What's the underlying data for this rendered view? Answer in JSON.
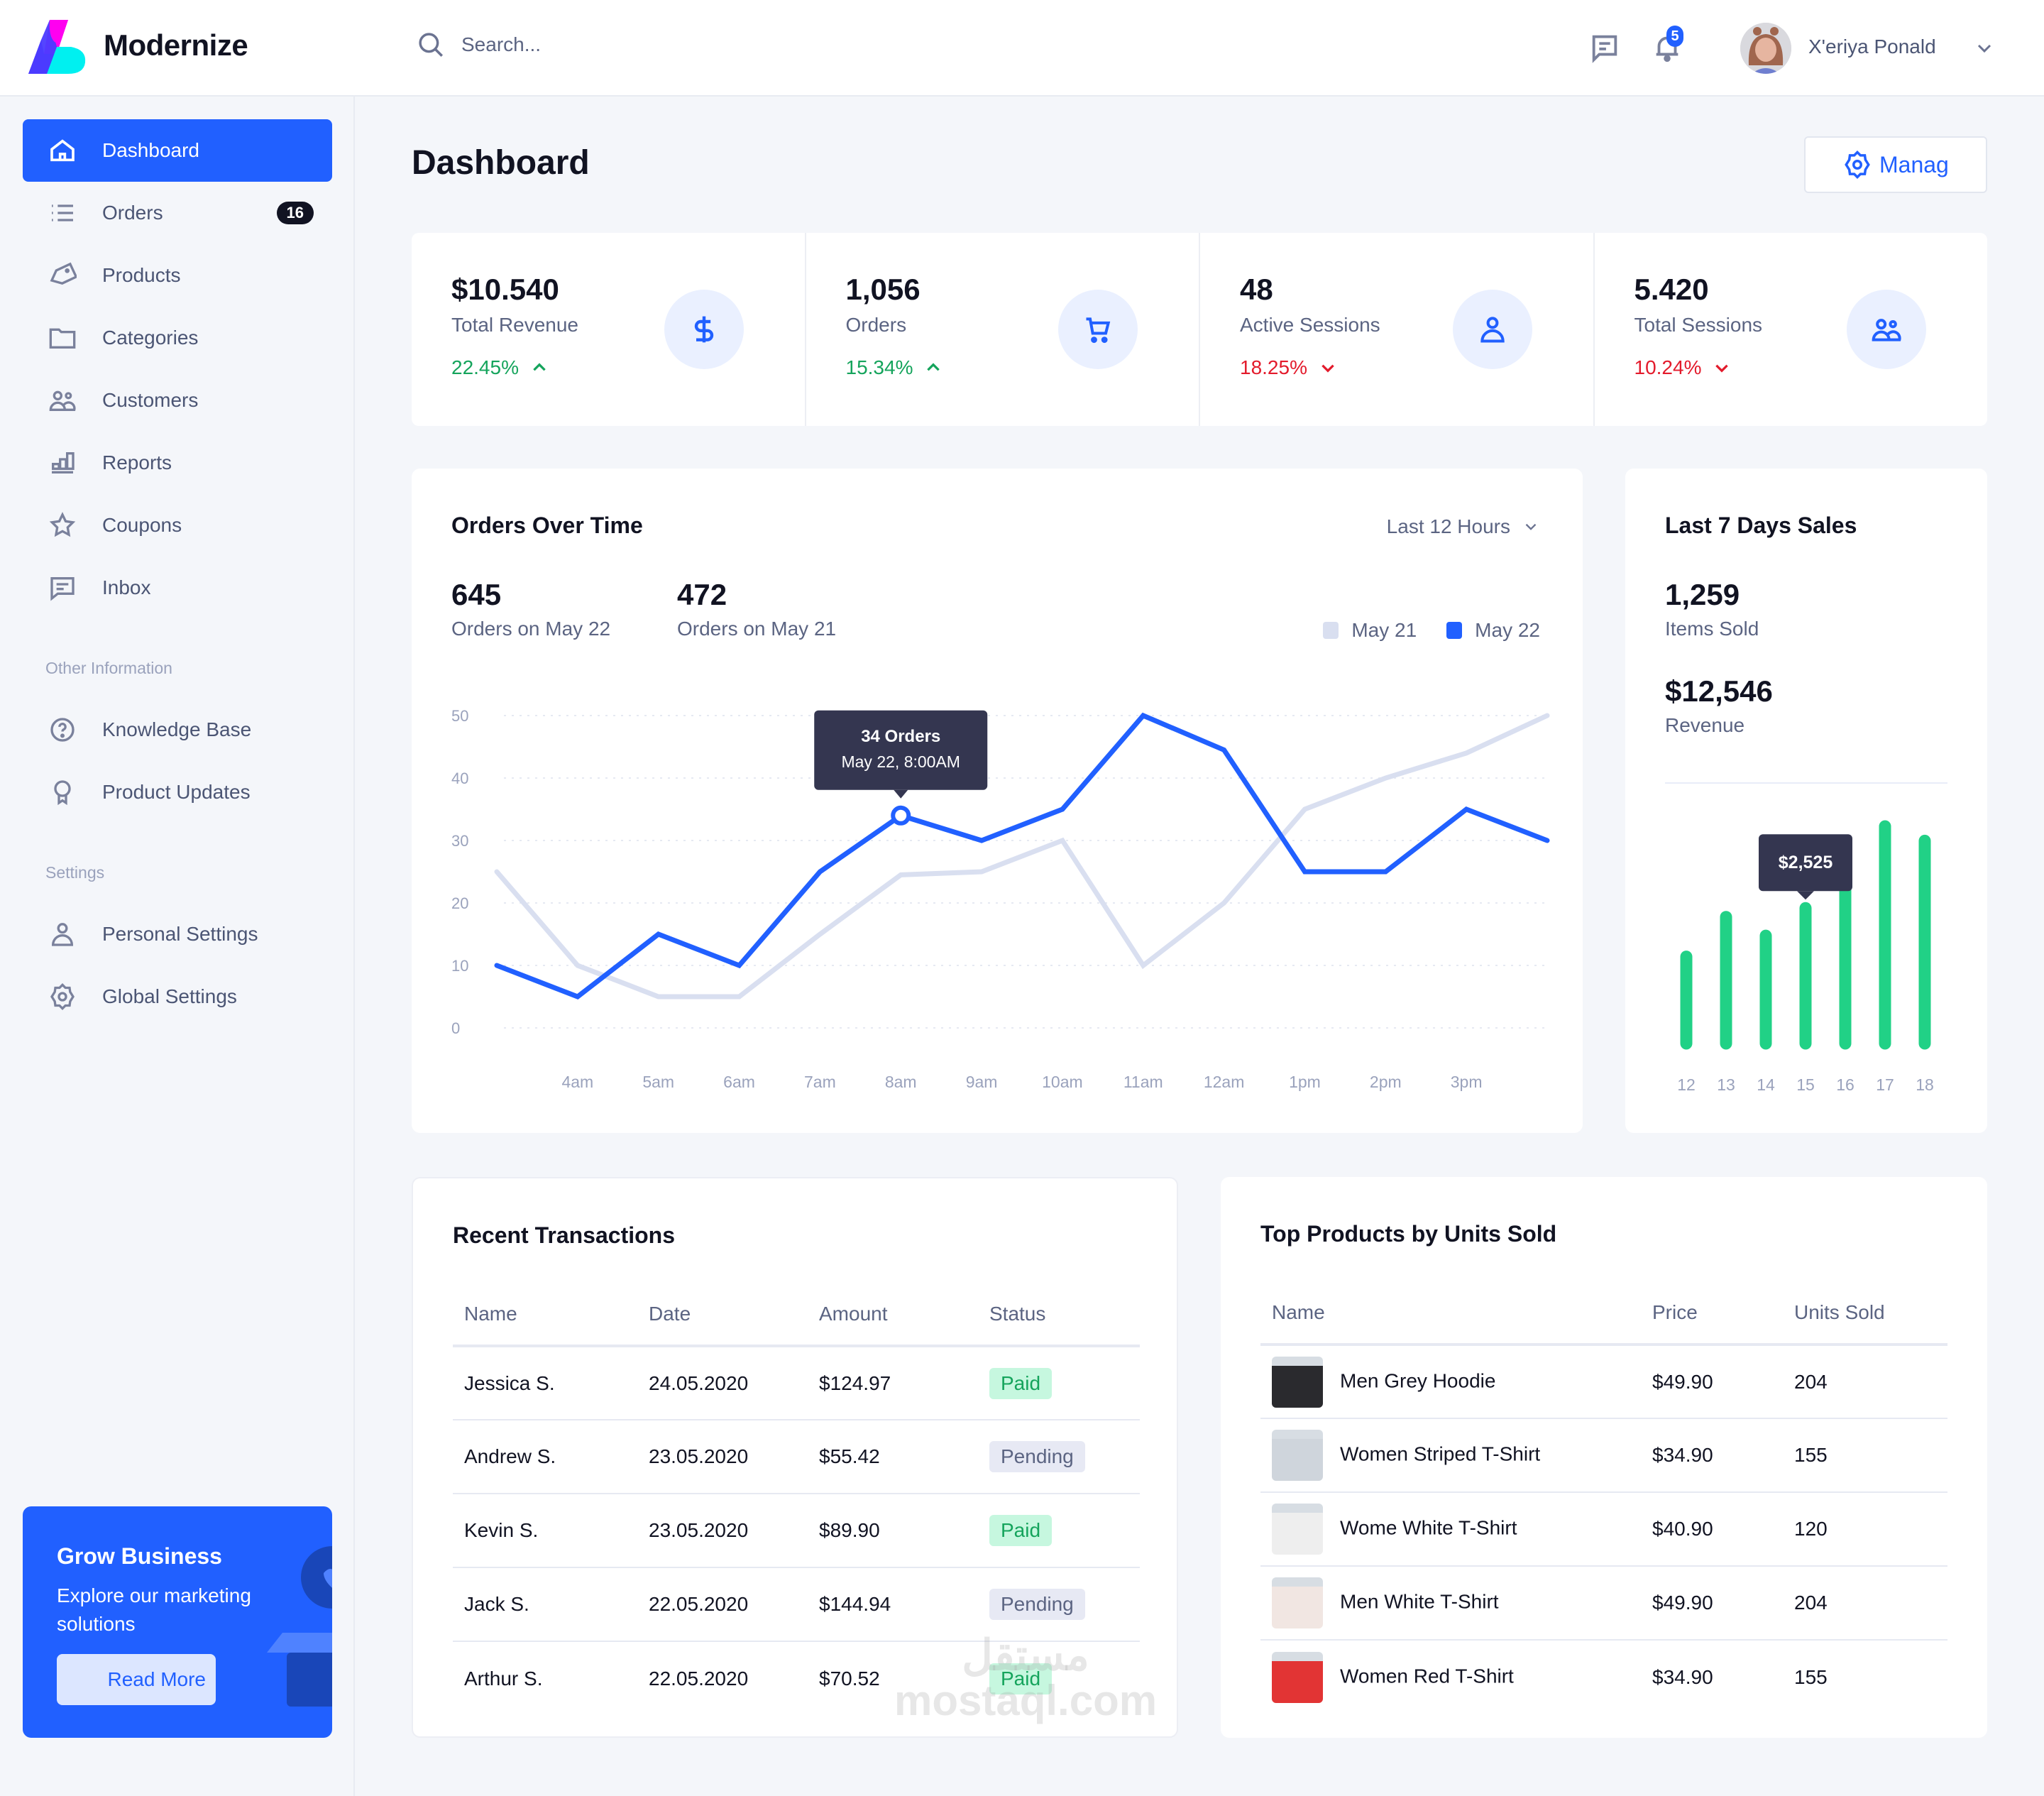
{
  "header": {
    "brand": "Modernize",
    "search_placeholder": "Search...",
    "notifications_count": "5",
    "user_name": "X'eriya Ponald"
  },
  "sidebar": {
    "items": [
      {
        "label": "Dashboard",
        "icon": "home-icon",
        "active": true
      },
      {
        "label": "Orders",
        "icon": "list-icon",
        "count": "16"
      },
      {
        "label": "Products",
        "icon": "tag-icon"
      },
      {
        "label": "Categories",
        "icon": "folder-icon"
      },
      {
        "label": "Customers",
        "icon": "users-icon"
      },
      {
        "label": "Reports",
        "icon": "bar-chart-icon"
      },
      {
        "label": "Coupons",
        "icon": "star-icon"
      },
      {
        "label": "Inbox",
        "icon": "message-icon"
      }
    ],
    "section_other": "Other Information",
    "other_items": [
      {
        "label": "Knowledge Base",
        "icon": "help-circle-icon"
      },
      {
        "label": "Product Updates",
        "icon": "award-icon"
      }
    ],
    "section_settings": "Settings",
    "settings_items": [
      {
        "label": "Personal Settings",
        "icon": "user-icon"
      },
      {
        "label": "Global Settings",
        "icon": "gear-icon"
      }
    ],
    "promo": {
      "title": "Grow Business",
      "text": "Explore our marketing solutions",
      "button": "Read More"
    }
  },
  "page": {
    "title": "Dashboard",
    "manage_button": "Manag"
  },
  "kpis": [
    {
      "value": "$10.540",
      "label": "Total Revenue",
      "delta": "22.45%",
      "trend": "up",
      "icon": "dollar-icon"
    },
    {
      "value": "1,056",
      "label": "Orders",
      "delta": "15.34%",
      "trend": "up",
      "icon": "cart-icon"
    },
    {
      "value": "48",
      "label": "Active Sessions",
      "delta": "18.25%",
      "trend": "down",
      "icon": "user-icon"
    },
    {
      "value": "5.420",
      "label": "Total Sessions",
      "delta": "10.24%",
      "trend": "down",
      "icon": "users-icon"
    }
  ],
  "orders_over_time": {
    "title": "Orders Over Time",
    "range": "Last 12 Hours",
    "stat1_value": "645",
    "stat1_label": "Orders on May 22",
    "stat2_value": "472",
    "stat2_label": "Orders on May 21",
    "tooltip_title": "34 Orders",
    "tooltip_sub": "May 22, 8:00AM"
  },
  "last7": {
    "title": "Last 7 Days Sales",
    "items_value": "1,259",
    "items_label": "Items Sold",
    "revenue_value": "$12,546",
    "revenue_label": "Revenue",
    "tooltip": "$2,525"
  },
  "chart_data": [
    {
      "type": "line",
      "title": "Orders Over Time",
      "x": [
        "",
        "4am",
        "5am",
        "6am",
        "7am",
        "8am",
        "9am",
        "10am",
        "11am",
        "12am",
        "1pm",
        "2pm",
        "3pm",
        ""
      ],
      "tick_labels": [
        "4am",
        "5am",
        "6am",
        "7am",
        "8am",
        "9am",
        "10am",
        "11am",
        "12am",
        "1pm",
        "2pm",
        "3pm"
      ],
      "yticks": [
        0,
        10,
        20,
        30,
        40,
        50
      ],
      "ylim": [
        0,
        50
      ],
      "grid": true,
      "legend_position": "top-right",
      "series": [
        {
          "name": "May 21",
          "color": "#d9dff0",
          "values": [
            25,
            10,
            5,
            5,
            15,
            24.5,
            25,
            30,
            10,
            20,
            35,
            40,
            44,
            50
          ]
        },
        {
          "name": "May 22",
          "color": "#2160ff",
          "values": [
            10,
            5,
            15,
            10,
            25,
            34,
            30,
            35,
            50,
            44.5,
            25,
            25,
            35,
            30
          ]
        }
      ],
      "highlight": {
        "series": "May 22",
        "index": 5,
        "label": "34 Orders",
        "sublabel": "May 22, 8:00AM"
      }
    },
    {
      "type": "bar",
      "title": "Last 7 Days Sales",
      "categories": [
        "12",
        "13",
        "14",
        "15",
        "16",
        "17",
        "18"
      ],
      "values": [
        1620,
        2360,
        2010,
        2525,
        3300,
        4050,
        3780
      ],
      "ylim": [
        0,
        4500
      ],
      "color": "#21d186",
      "highlight": {
        "index": 3,
        "label": "$2,525"
      }
    }
  ],
  "transactions": {
    "title": "Recent Transactions",
    "columns": [
      "Name",
      "Date",
      "Amount",
      "Status"
    ],
    "rows": [
      {
        "name": "Jessica S.",
        "date": "24.05.2020",
        "amount": "$124.97",
        "status": "Paid"
      },
      {
        "name": "Andrew S.",
        "date": "23.05.2020",
        "amount": "$55.42",
        "status": "Pending"
      },
      {
        "name": "Kevin S.",
        "date": "23.05.2020",
        "amount": "$89.90",
        "status": "Paid"
      },
      {
        "name": "Jack S.",
        "date": "22.05.2020",
        "amount": "$144.94",
        "status": "Pending"
      },
      {
        "name": "Arthur S.",
        "date": "22.05.2020",
        "amount": "$70.52",
        "status": "Paid"
      }
    ]
  },
  "top_products": {
    "title": "Top Products by Units Sold",
    "columns": [
      "Name",
      "Price",
      "Units Sold"
    ],
    "rows": [
      {
        "name": "Men Grey Hoodie",
        "price": "$49.90",
        "units": "204",
        "thumb_color": "#2a2a2e"
      },
      {
        "name": "Women Striped T-Shirt",
        "price": "$34.90",
        "units": "155",
        "thumb_color": "#cfd5dc"
      },
      {
        "name": "Wome White T-Shirt",
        "price": "$40.90",
        "units": "120",
        "thumb_color": "#eeeeee"
      },
      {
        "name": "Men White T-Shirt",
        "price": "$49.90",
        "units": "204",
        "thumb_color": "#f1e6e2"
      },
      {
        "name": "Women Red T-Shirt",
        "price": "$34.90",
        "units": "155",
        "thumb_color": "#e23434"
      }
    ]
  },
  "watermark": {
    "line1": "مستقل",
    "line2": "mostaql.com"
  }
}
